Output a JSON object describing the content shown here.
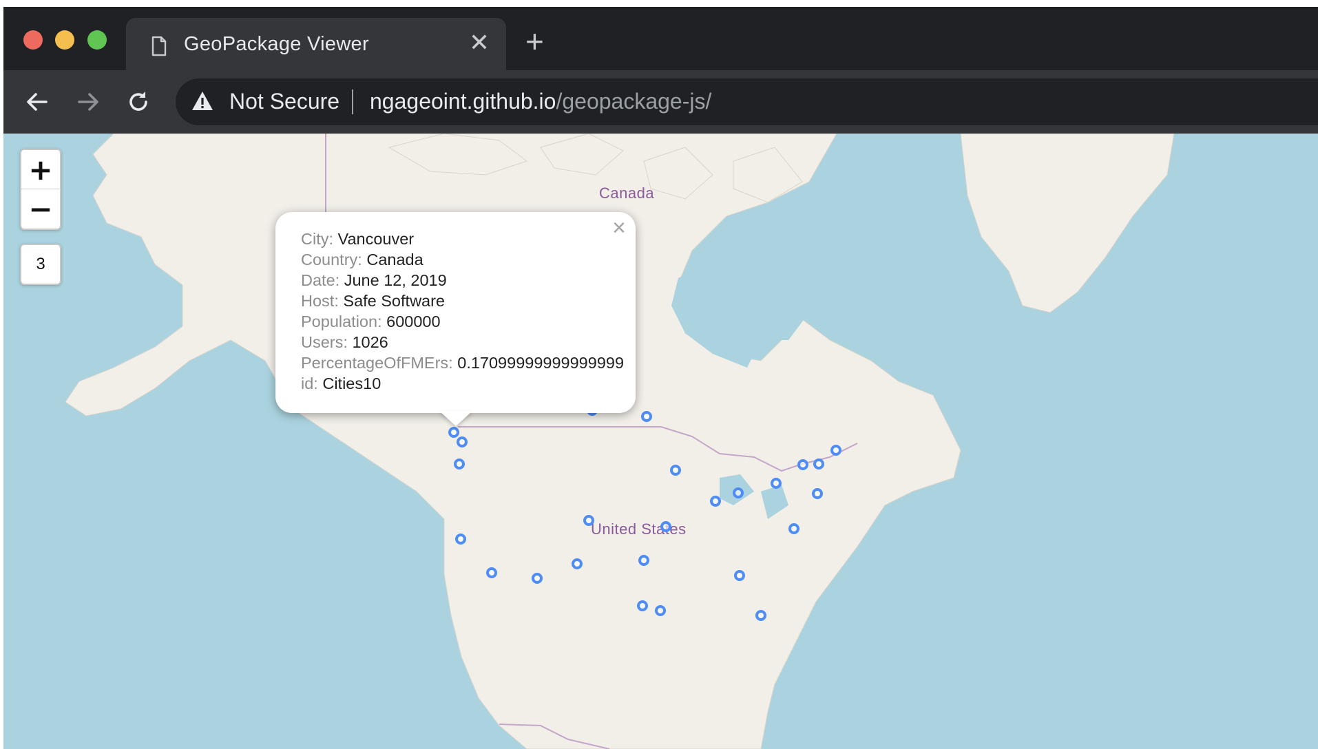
{
  "browser": {
    "tab_title": "GeoPackage Viewer",
    "tab_close": "✕",
    "new_tab": "+",
    "security_label": "Not Secure",
    "url_host": "ngageoint.github.io",
    "url_path": "/geopackage-js/"
  },
  "map": {
    "zoom_in_label": "+",
    "zoom_out_label": "−",
    "zoom_level": "3",
    "labels": {
      "canada": "Canada",
      "united_states": "United States"
    },
    "water_color": "#aad3df",
    "land_color": "#f2efe9",
    "marker_color": "#4d8df5"
  },
  "popup": {
    "close_label": "×",
    "rows": [
      {
        "key": "City:",
        "value": "Vancouver"
      },
      {
        "key": "Country:",
        "value": "Canada"
      },
      {
        "key": "Date:",
        "value": "June 12, 2019"
      },
      {
        "key": "Host:",
        "value": "Safe Software"
      },
      {
        "key": "Population:",
        "value": "600000"
      },
      {
        "key": "Users:",
        "value": "1026"
      },
      {
        "key": "PercentageOfFMErs:",
        "value": "0.17099999999999999"
      },
      {
        "key": "id:",
        "value": "Cities10"
      }
    ]
  }
}
